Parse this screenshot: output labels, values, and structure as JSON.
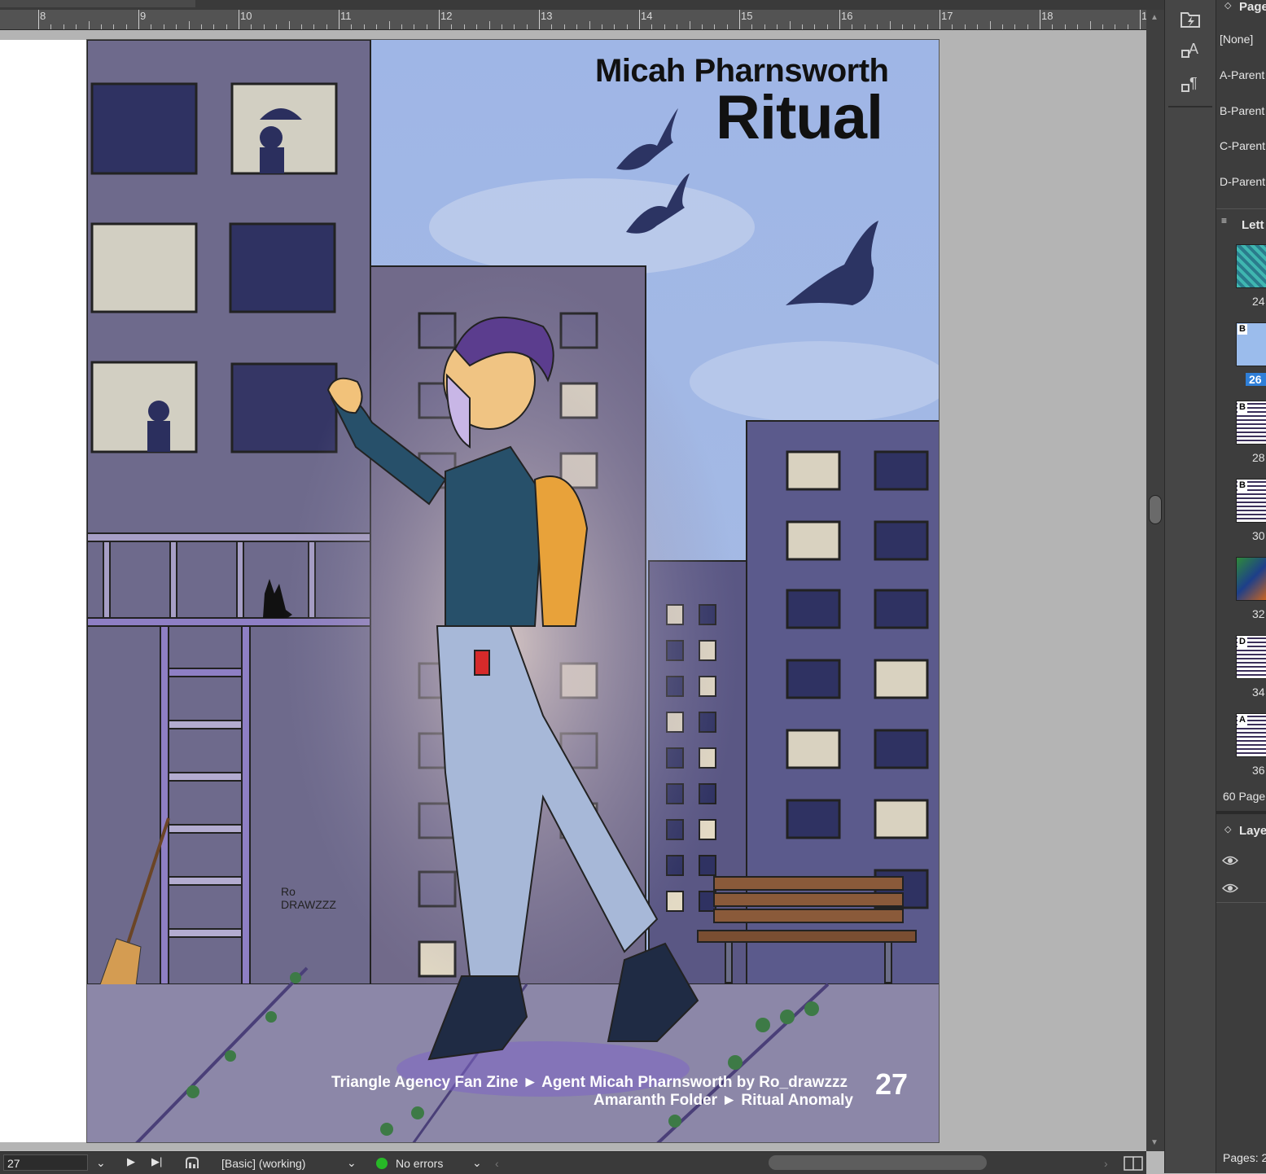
{
  "ruler": {
    "labels": [
      "8",
      "9",
      "10",
      "11",
      "12",
      "13",
      "14",
      "15",
      "16",
      "17",
      "18",
      "1"
    ]
  },
  "artwork": {
    "author": "Micah Pharnsworth",
    "title": "Ritual",
    "footer_line1": "Triangle Agency Fan Zine ► Agent Micah Pharnsworth by Ro_drawzzz",
    "footer_line2": "Amaranth Folder ► Ritual Anomaly",
    "page_number": "27",
    "signature": "Ro DRAWZZZ"
  },
  "pages_panel": {
    "title": "Page",
    "parents": [
      "[None]",
      "A-Parent",
      "B-Parent",
      "C-Parent",
      "D-Parent"
    ],
    "section_label": "Lett",
    "thumbnails": [
      {
        "badge": "",
        "number": "24"
      },
      {
        "badge": "B",
        "number": "26"
      },
      {
        "badge": "B",
        "number": "28"
      },
      {
        "badge": "B",
        "number": "30"
      },
      {
        "badge": "",
        "number": "32"
      },
      {
        "badge": "D",
        "number": "34"
      },
      {
        "badge": "A",
        "number": "36"
      }
    ],
    "page_count": "60 Page",
    "pages_status": "Pages: 2"
  },
  "layers_panel": {
    "title": "Laye"
  },
  "status_bar": {
    "page_field": "27",
    "preflight_profile": "[Basic] (working)",
    "preflight_status": "No errors",
    "status_color": "#27b827"
  },
  "icons": {
    "tools": [
      "lightning-folder-icon",
      "character-styles-icon",
      "paragraph-styles-icon"
    ],
    "layers": [
      "eye-icon",
      "eye-icon"
    ]
  }
}
